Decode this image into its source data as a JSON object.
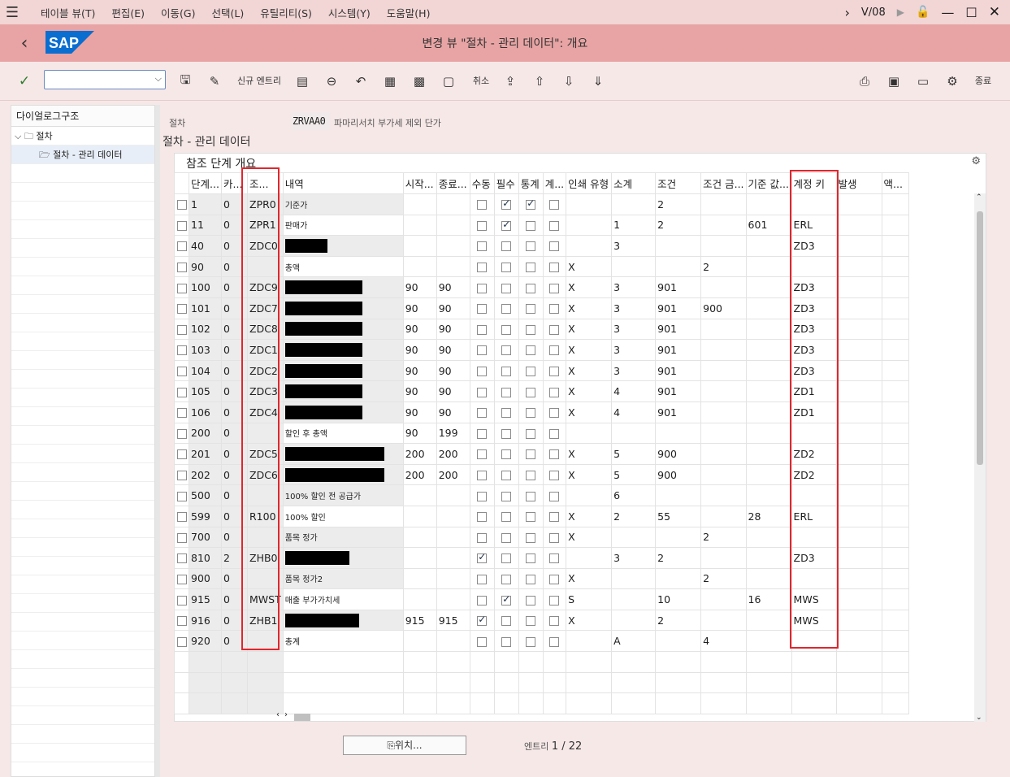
{
  "menu": {
    "items": [
      "테이블 뷰(T)",
      "편집(E)",
      "이동(G)",
      "선택(L)",
      "유틸리티(S)",
      "시스템(Y)",
      "도움말(H)"
    ],
    "tcode": "V/08"
  },
  "header": {
    "title": "변경 뷰 \"절차 - 관리 데이터\": 개요",
    "logo": "SAP"
  },
  "toolbar": {
    "new_entry": "신규 엔트리",
    "cancel": "취소",
    "exit": "종료",
    "command_placeholder": ""
  },
  "sidebar": {
    "title": "다이얼로그구조",
    "items": [
      "절차",
      "절차 - 관리 데이터"
    ]
  },
  "procedure": {
    "label": "절차",
    "value": "ZRVAA0",
    "description": "파마리서치 부가세 제외 단가"
  },
  "section_title": "절차 - 관리 데이터",
  "table": {
    "title": "참조 단계 개요",
    "columns": [
      "단계...",
      "카...",
      "조...",
      "내역",
      "시작...",
      "종료...",
      "수동",
      "필수",
      "통계",
      "계...",
      "인쇄 유형",
      "소계",
      "조건",
      "조건 금...",
      "기준 값...",
      "계정 키",
      "발생",
      "액..."
    ],
    "rows": [
      {
        "step": "1",
        "cnt": "0",
        "ctyp": "ZPR0",
        "desc": "기준가",
        "from": "",
        "to": "",
        "manual": false,
        "req": true,
        "stat": true,
        "acct": false,
        "print": "",
        "subtot": "",
        "reqmt": "2",
        "altcty": "",
        "altbv": "",
        "actkey": "",
        "redact": 0
      },
      {
        "step": "11",
        "cnt": "0",
        "ctyp": "ZPR1",
        "desc": "판매가",
        "from": "",
        "to": "",
        "manual": false,
        "req": true,
        "stat": false,
        "acct": false,
        "print": "",
        "subtot": "1",
        "reqmt": "2",
        "altcty": "",
        "altbv": "601",
        "actkey": "ERL",
        "redact": 0
      },
      {
        "step": "40",
        "cnt": "0",
        "ctyp": "ZDC0",
        "desc": "",
        "from": "",
        "to": "",
        "manual": false,
        "req": false,
        "stat": false,
        "acct": false,
        "print": "",
        "subtot": "3",
        "reqmt": "",
        "altcty": "",
        "altbv": "",
        "actkey": "ZD3",
        "redact": 52
      },
      {
        "step": "90",
        "cnt": "0",
        "ctyp": "",
        "desc": "총액",
        "from": "",
        "to": "",
        "manual": false,
        "req": false,
        "stat": false,
        "acct": false,
        "print": "X",
        "subtot": "",
        "reqmt": "",
        "altcty": "2",
        "altbv": "",
        "actkey": "",
        "redact": 0
      },
      {
        "step": "100",
        "cnt": "0",
        "ctyp": "ZDC9",
        "desc": "",
        "from": "90",
        "to": "90",
        "manual": false,
        "req": false,
        "stat": false,
        "acct": false,
        "print": "X",
        "subtot": "3",
        "reqmt": "901",
        "altcty": "",
        "altbv": "",
        "actkey": "ZD3",
        "redact": 95
      },
      {
        "step": "101",
        "cnt": "0",
        "ctyp": "ZDC7",
        "desc": "",
        "from": "90",
        "to": "90",
        "manual": false,
        "req": false,
        "stat": false,
        "acct": false,
        "print": "X",
        "subtot": "3",
        "reqmt": "901",
        "altcty": "900",
        "altbv": "",
        "actkey": "ZD3",
        "redact": 95
      },
      {
        "step": "102",
        "cnt": "0",
        "ctyp": "ZDC8",
        "desc": "",
        "from": "90",
        "to": "90",
        "manual": false,
        "req": false,
        "stat": false,
        "acct": false,
        "print": "X",
        "subtot": "3",
        "reqmt": "901",
        "altcty": "",
        "altbv": "",
        "actkey": "ZD3",
        "redact": 95
      },
      {
        "step": "103",
        "cnt": "0",
        "ctyp": "ZDC1",
        "desc": "",
        "from": "90",
        "to": "90",
        "manual": false,
        "req": false,
        "stat": false,
        "acct": false,
        "print": "X",
        "subtot": "3",
        "reqmt": "901",
        "altcty": "",
        "altbv": "",
        "actkey": "ZD3",
        "redact": 95
      },
      {
        "step": "104",
        "cnt": "0",
        "ctyp": "ZDC2",
        "desc": "",
        "from": "90",
        "to": "90",
        "manual": false,
        "req": false,
        "stat": false,
        "acct": false,
        "print": "X",
        "subtot": "3",
        "reqmt": "901",
        "altcty": "",
        "altbv": "",
        "actkey": "ZD3",
        "redact": 95
      },
      {
        "step": "105",
        "cnt": "0",
        "ctyp": "ZDC3",
        "desc": "",
        "from": "90",
        "to": "90",
        "manual": false,
        "req": false,
        "stat": false,
        "acct": false,
        "print": "X",
        "subtot": "4",
        "reqmt": "901",
        "altcty": "",
        "altbv": "",
        "actkey": "ZD1",
        "redact": 95
      },
      {
        "step": "106",
        "cnt": "0",
        "ctyp": "ZDC4",
        "desc": "",
        "from": "90",
        "to": "90",
        "manual": false,
        "req": false,
        "stat": false,
        "acct": false,
        "print": "X",
        "subtot": "4",
        "reqmt": "901",
        "altcty": "",
        "altbv": "",
        "actkey": "ZD1",
        "redact": 95
      },
      {
        "step": "200",
        "cnt": "0",
        "ctyp": "",
        "desc": "할인 후 총액",
        "from": "90",
        "to": "199",
        "manual": false,
        "req": false,
        "stat": false,
        "acct": false,
        "print": "",
        "subtot": "",
        "reqmt": "",
        "altcty": "",
        "altbv": "",
        "actkey": "",
        "redact": 0
      },
      {
        "step": "201",
        "cnt": "0",
        "ctyp": "ZDC5",
        "desc": "",
        "from": "200",
        "to": "200",
        "manual": false,
        "req": false,
        "stat": false,
        "acct": false,
        "print": "X",
        "subtot": "5",
        "reqmt": "900",
        "altcty": "",
        "altbv": "",
        "actkey": "ZD2",
        "redact": 122
      },
      {
        "step": "202",
        "cnt": "0",
        "ctyp": "ZDC6",
        "desc": "",
        "from": "200",
        "to": "200",
        "manual": false,
        "req": false,
        "stat": false,
        "acct": false,
        "print": "X",
        "subtot": "5",
        "reqmt": "900",
        "altcty": "",
        "altbv": "",
        "actkey": "ZD2",
        "redact": 122
      },
      {
        "step": "500",
        "cnt": "0",
        "ctyp": "",
        "desc": "100% 할인 전 공급가",
        "from": "",
        "to": "",
        "manual": false,
        "req": false,
        "stat": false,
        "acct": false,
        "print": "",
        "subtot": "6",
        "reqmt": "",
        "altcty": "",
        "altbv": "",
        "actkey": "",
        "redact": 0
      },
      {
        "step": "599",
        "cnt": "0",
        "ctyp": "R100",
        "desc": "100% 할인",
        "from": "",
        "to": "",
        "manual": false,
        "req": false,
        "stat": false,
        "acct": false,
        "print": "X",
        "subtot": "2",
        "reqmt": "55",
        "altcty": "",
        "altbv": "28",
        "actkey": "ERL",
        "redact": 0
      },
      {
        "step": "700",
        "cnt": "0",
        "ctyp": "",
        "desc": "품목 정가",
        "from": "",
        "to": "",
        "manual": false,
        "req": false,
        "stat": false,
        "acct": false,
        "print": "X",
        "subtot": "",
        "reqmt": "",
        "altcty": "2",
        "altbv": "",
        "actkey": "",
        "redact": 0
      },
      {
        "step": "810",
        "cnt": "2",
        "ctyp": "ZHB0",
        "desc": "",
        "from": "",
        "to": "",
        "manual": true,
        "req": false,
        "stat": false,
        "acct": false,
        "print": "",
        "subtot": "3",
        "reqmt": "2",
        "altcty": "",
        "altbv": "",
        "actkey": "ZD3",
        "redact": 79
      },
      {
        "step": "900",
        "cnt": "0",
        "ctyp": "",
        "desc": "품목 정가2",
        "from": "",
        "to": "",
        "manual": false,
        "req": false,
        "stat": false,
        "acct": false,
        "print": "X",
        "subtot": "",
        "reqmt": "",
        "altcty": "2",
        "altbv": "",
        "actkey": "",
        "redact": 0
      },
      {
        "step": "915",
        "cnt": "0",
        "ctyp": "MWST",
        "desc": "매출 부가가치세",
        "from": "",
        "to": "",
        "manual": false,
        "req": true,
        "stat": false,
        "acct": false,
        "print": "S",
        "subtot": "",
        "reqmt": "10",
        "altcty": "",
        "altbv": "16",
        "actkey": "MWS",
        "redact": 0
      },
      {
        "step": "916",
        "cnt": "0",
        "ctyp": "ZHB1",
        "desc": "",
        "from": "915",
        "to": "915",
        "manual": true,
        "req": false,
        "stat": false,
        "acct": false,
        "print": "X",
        "subtot": "",
        "reqmt": "2",
        "altcty": "",
        "altbv": "",
        "actkey": "MWS",
        "redact": 91
      },
      {
        "step": "920",
        "cnt": "0",
        "ctyp": "",
        "desc": "총계",
        "from": "",
        "to": "",
        "manual": false,
        "req": false,
        "stat": false,
        "acct": false,
        "print": "",
        "subtot": "A",
        "reqmt": "",
        "altcty": "4",
        "altbv": "",
        "actkey": "",
        "redact": 0
      }
    ],
    "empty_rows": 3
  },
  "footer": {
    "position_button": "위치...",
    "entries_label": "엔트리",
    "entries_value": "1 / 22"
  },
  "colors": {
    "title_bar": "#e8a4a4",
    "menu_bar": "#f2d5d5",
    "highlight_box": "#e0262d",
    "sap_blue": "#0a6ed1"
  }
}
